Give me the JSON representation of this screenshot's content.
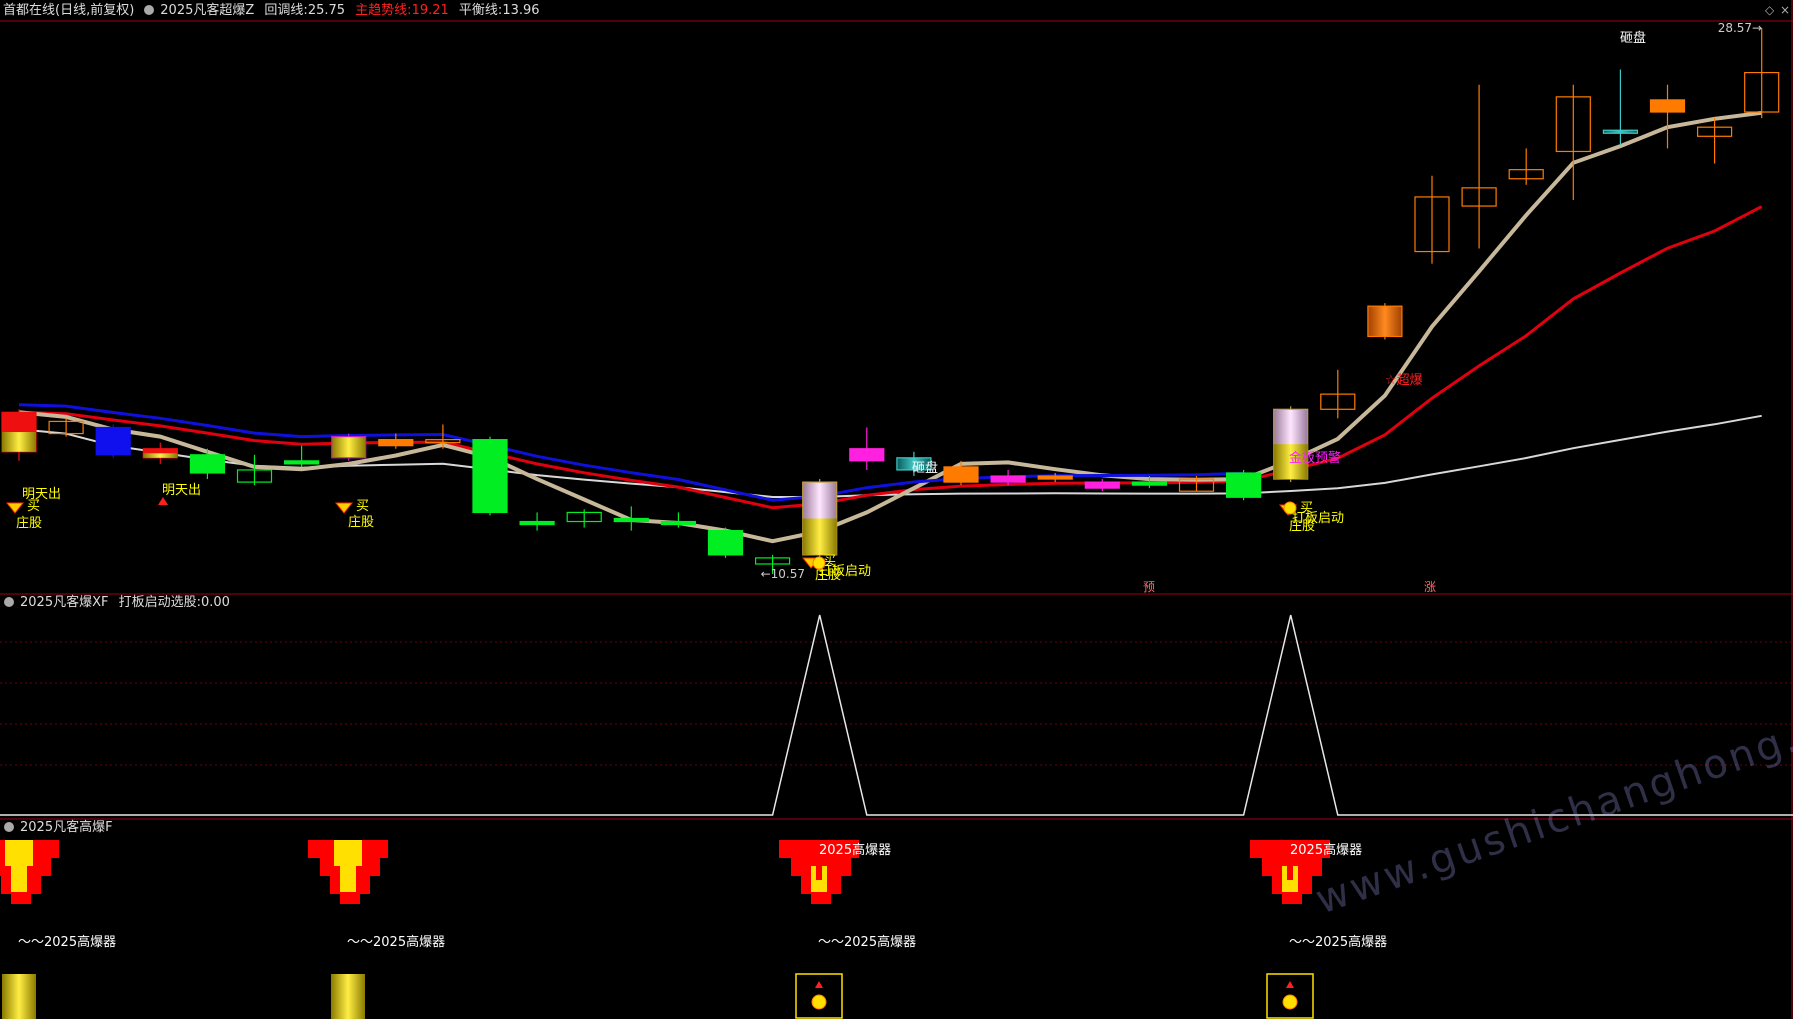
{
  "header_main": {
    "stock": "首都在线(日线,前复权)",
    "indicator": "2025凡客超爆Z",
    "retrace_label": "回调线:",
    "retrace_value": "25.75",
    "trend_label": "主趋势线:",
    "trend_value": "19.21",
    "balance_label": "平衡线:",
    "balance_value": "13.96"
  },
  "header_sub1": {
    "indicator": "2025凡客爆XF",
    "field_label": "打板启动选股:",
    "field_value": "0.00"
  },
  "header_sub2": {
    "indicator": "2025凡客高爆F"
  },
  "colors": {
    "background": "#000000",
    "up": "#ff7b00",
    "down": "#00ee22",
    "border": "#a00010",
    "retrace": "#c8b89a",
    "trend": "#e00010",
    "balance": "#d8d8d8",
    "blue": "#1010dd"
  },
  "chart_data": {
    "type": "candlestick",
    "price_high_label": "28.57",
    "price_low_label": "10.57",
    "candles": [
      {
        "o": 14.6,
        "c": 15.9,
        "h": 16.0,
        "l": 14.3,
        "color": "red"
      },
      {
        "o": 15.2,
        "c": 15.6,
        "h": 15.7,
        "l": 15.1,
        "color": "orange_hollow"
      },
      {
        "o": 15.4,
        "c": 14.5,
        "h": 15.5,
        "l": 14.4,
        "color": "blue"
      },
      {
        "o": 14.7,
        "c": 14.4,
        "h": 14.9,
        "l": 14.2,
        "color": "red"
      },
      {
        "o": 14.5,
        "c": 13.9,
        "h": 14.7,
        "l": 13.7,
        "color": "green"
      },
      {
        "o": 14.0,
        "c": 13.6,
        "h": 14.5,
        "l": 13.5,
        "color": "green_hollow"
      },
      {
        "o": 14.3,
        "c": 14.2,
        "h": 14.8,
        "l": 14.1,
        "color": "green"
      },
      {
        "o": 14.4,
        "c": 15.1,
        "h": 15.2,
        "l": 14.3,
        "color": "gold_purple"
      },
      {
        "o": 14.8,
        "c": 15.0,
        "h": 15.2,
        "l": 14.7,
        "color": "orange"
      },
      {
        "o": 14.9,
        "c": 15.0,
        "h": 15.5,
        "l": 14.7,
        "color": "orange_hollow"
      },
      {
        "o": 15.0,
        "c": 12.6,
        "h": 15.1,
        "l": 12.5,
        "color": "green"
      },
      {
        "o": 12.3,
        "c": 12.2,
        "h": 12.6,
        "l": 12.0,
        "color": "green"
      },
      {
        "o": 12.6,
        "c": 12.3,
        "h": 12.7,
        "l": 12.1,
        "color": "green_hollow"
      },
      {
        "o": 12.4,
        "c": 12.3,
        "h": 12.8,
        "l": 12.0,
        "color": "green"
      },
      {
        "o": 12.3,
        "c": 12.2,
        "h": 12.6,
        "l": 12.1,
        "color": "green"
      },
      {
        "o": 12.0,
        "c": 11.2,
        "h": 12.1,
        "l": 11.1,
        "color": "green"
      },
      {
        "o": 11.1,
        "c": 10.9,
        "h": 11.2,
        "l": 10.57,
        "color": "green_hollow"
      },
      {
        "o": 11.2,
        "c": 13.6,
        "h": 13.7,
        "l": 11.0,
        "color": "pink_gold"
      },
      {
        "o": 14.3,
        "c": 14.7,
        "h": 15.4,
        "l": 14.0,
        "color": "magenta"
      },
      {
        "o": 14.0,
        "c": 14.4,
        "h": 14.6,
        "l": 13.8,
        "color": "cyan"
      },
      {
        "o": 13.6,
        "c": 14.1,
        "h": 14.3,
        "l": 13.5,
        "color": "orange"
      },
      {
        "o": 13.6,
        "c": 13.8,
        "h": 14.0,
        "l": 13.5,
        "color": "magenta"
      },
      {
        "o": 13.7,
        "c": 13.8,
        "h": 13.9,
        "l": 13.6,
        "color": "orange"
      },
      {
        "o": 13.4,
        "c": 13.6,
        "h": 13.7,
        "l": 13.3,
        "color": "magenta"
      },
      {
        "o": 13.5,
        "c": 13.6,
        "h": 13.8,
        "l": 13.4,
        "color": "green"
      },
      {
        "o": 13.3,
        "c": 13.7,
        "h": 13.8,
        "l": 13.3,
        "color": "orange_hollow"
      },
      {
        "o": 13.1,
        "c": 13.9,
        "h": 14.0,
        "l": 13.0,
        "color": "green"
      },
      {
        "o": 13.7,
        "c": 16.0,
        "h": 16.1,
        "l": 13.6,
        "color": "pink_gold"
      },
      {
        "o": 16.0,
        "c": 16.5,
        "h": 17.3,
        "l": 15.7,
        "color": "orange_hollow"
      },
      {
        "o": 18.4,
        "c": 19.4,
        "h": 19.5,
        "l": 18.3,
        "color": "orange_stripe"
      },
      {
        "o": 21.2,
        "c": 23.0,
        "h": 23.7,
        "l": 20.8,
        "color": "orange_hollow"
      },
      {
        "o": 22.7,
        "c": 23.3,
        "h": 26.7,
        "l": 21.3,
        "color": "orange_hollow"
      },
      {
        "o": 23.6,
        "c": 23.9,
        "h": 24.6,
        "l": 23.4,
        "color": "orange_hollow"
      },
      {
        "o": 24.5,
        "c": 26.3,
        "h": 26.7,
        "l": 22.9,
        "color": "orange_hollow"
      },
      {
        "o": 25.1,
        "c": 25.2,
        "h": 27.2,
        "l": 24.7,
        "color": "cyan"
      },
      {
        "o": 26.2,
        "c": 25.8,
        "h": 26.7,
        "l": 24.6,
        "color": "orange"
      },
      {
        "o": 25.3,
        "c": 25.0,
        "h": 25.6,
        "l": 24.1,
        "color": "orange_hollow"
      },
      {
        "o": 25.8,
        "c": 27.1,
        "h": 28.57,
        "l": 25.6,
        "color": "orange_hollow"
      }
    ],
    "sub1": {
      "type": "line",
      "values": [
        0,
        0,
        0,
        0,
        0,
        0,
        0,
        0,
        0,
        0,
        0,
        0,
        0,
        0,
        0,
        0,
        0,
        1,
        0,
        0,
        0,
        0,
        0,
        0,
        0,
        0,
        0,
        1,
        0,
        0,
        0,
        0,
        0,
        0,
        0,
        0,
        0,
        0
      ]
    }
  },
  "annotations": {
    "sell_tomorrow": "明天出",
    "buy": "买",
    "dealer": "庄股",
    "board_start": "打板启动",
    "dump": "砸盘",
    "super_explode": "超爆",
    "board_warning": "金板预警",
    "pre": "预",
    "rise": "涨",
    "highburst": "2025高爆器",
    "highburst_tilde": "～～2025高爆器"
  },
  "watermark": "www.gushichanghong.com"
}
